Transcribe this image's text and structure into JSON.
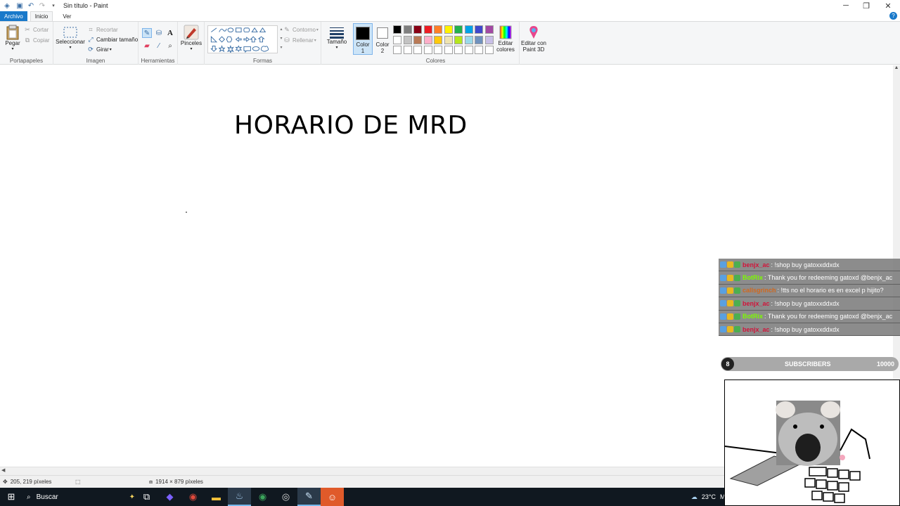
{
  "window": {
    "title": "Sin título - Paint",
    "controls": [
      "minimize",
      "restore",
      "close"
    ]
  },
  "tabs": [
    {
      "label": "Archivo"
    },
    {
      "label": "Inicio"
    },
    {
      "label": "Ver"
    }
  ],
  "ribbon": {
    "portapapeles": {
      "label": "Portapapeles",
      "pegar": "Pegar",
      "cortar": "Cortar",
      "copiar": "Copiar"
    },
    "imagen": {
      "label": "Imagen",
      "seleccionar": "Seleccionar",
      "recortar": "Recortar",
      "cambiar_tamano": "Cambiar tamaño",
      "girar": "Girar"
    },
    "herramientas": {
      "label": "Herramientas"
    },
    "pinceles": "Pinceles",
    "formas": {
      "label": "Formas",
      "contorno": "Contorno",
      "rellenar": "Rellenar"
    },
    "tamano": "Tamaño",
    "color1": {
      "label_line1": "Color",
      "label_line2": "1",
      "color": "#000000"
    },
    "color2": {
      "label_line1": "Color",
      "label_line2": "2",
      "color": "#ffffff"
    },
    "colores": {
      "label": "Colores",
      "palette_row1": [
        "#000000",
        "#7f7f7f",
        "#880015",
        "#ed1c24",
        "#ff7f27",
        "#fff200",
        "#22b14c",
        "#00a2e8",
        "#3f48cc",
        "#a349a4"
      ],
      "palette_row2": [
        "#ffffff",
        "#c3c3c3",
        "#b97a57",
        "#ffaec9",
        "#ffc90e",
        "#efe4b0",
        "#b5e61d",
        "#99d9ea",
        "#7092be",
        "#c8bfe7"
      ],
      "palette_row3": [
        "#ffffff",
        "#ffffff",
        "#ffffff",
        "#ffffff",
        "#ffffff",
        "#ffffff",
        "#ffffff",
        "#ffffff",
        "#ffffff",
        "#ffffff"
      ]
    },
    "editar_colores": {
      "line1": "Editar",
      "line2": "colores"
    },
    "paint3d": {
      "line1": "Editar con",
      "line2": "Paint 3D"
    }
  },
  "canvas": {
    "text": "HORARIO DE MRD"
  },
  "status": {
    "cursor": "205, 219 píxeles",
    "size": "1914 × 879 píxeles"
  },
  "taskbar": {
    "search": "Buscar",
    "temperature": "23°C",
    "weather_text": "Mayo"
  },
  "chat": [
    {
      "user": "benjx_ac",
      "user_color": "#d2143a",
      "message": ": !shop buy gatoxxddxdx"
    },
    {
      "user": "BotRix",
      "user_color": "#7cfc00",
      "message": ": Thank you for redeeming gatoxd @benjx_ac"
    },
    {
      "user": "callsgrinch",
      "user_color": "#d2691e",
      "message": ": !tts no el horario es en excel p hijito?"
    },
    {
      "user": "benjx_ac",
      "user_color": "#d2143a",
      "message": ": !shop buy gatoxxddxdx"
    },
    {
      "user": "BotRix",
      "user_color": "#7cfc00",
      "message": ": Thank you for redeeming gatoxd @benjx_ac"
    },
    {
      "user": "benjx_ac",
      "user_color": "#d2143a",
      "message": ": !shop buy gatoxxddxdx"
    }
  ],
  "subs": {
    "count": "8",
    "label": "SUBSCRIBERS",
    "goal": "10000"
  }
}
